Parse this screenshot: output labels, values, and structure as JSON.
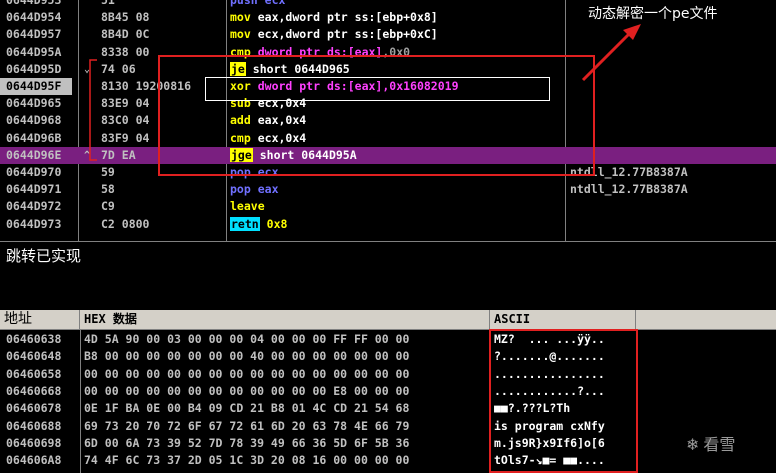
{
  "disasm": {
    "rows": [
      {
        "addr": "0644D953",
        "bytes": "51",
        "op": "push",
        "args": [
          {
            "t": "ecx",
            "c": "push"
          }
        ],
        "comment": ""
      },
      {
        "addr": "0644D954",
        "bytes": "8B45 08",
        "op": "mov",
        "args": [
          {
            "t": "eax,dword ptr ss:[ebp+0x8]",
            "c": "w"
          }
        ],
        "comment": ""
      },
      {
        "addr": "0644D957",
        "bytes": "8B4D 0C",
        "op": "mov",
        "args": [
          {
            "t": "ecx,dword ptr ss:[ebp+0xC]",
            "c": "w"
          }
        ],
        "comment": ""
      },
      {
        "addr": "0644D95A",
        "bytes": "8338 00",
        "op": "cmp",
        "args": [
          {
            "t": "dword ptr ds:[eax]",
            "c": "mem"
          },
          {
            "t": ",0x0",
            "c": "imm"
          }
        ],
        "comment": ""
      },
      {
        "addr": "0644D95D",
        "bytes": "74 06",
        "op": "je",
        "args": [
          {
            "t": "short 0644D965",
            "c": "w"
          }
        ],
        "comment": ""
      },
      {
        "addr": "0644D95F",
        "bytes": "8130 19200816",
        "op": "xor",
        "args": [
          {
            "t": "dword ptr ds:[eax]",
            "c": "mem"
          },
          {
            "t": ",0x16082019",
            "c": "imm"
          }
        ],
        "comment": ""
      },
      {
        "addr": "0644D965",
        "bytes": "83E9 04",
        "op": "sub",
        "args": [
          {
            "t": "ecx,0x4",
            "c": "w"
          }
        ],
        "comment": ""
      },
      {
        "addr": "0644D968",
        "bytes": "83C0 04",
        "op": "add",
        "args": [
          {
            "t": "eax,0x4",
            "c": "w"
          }
        ],
        "comment": ""
      },
      {
        "addr": "0644D96B",
        "bytes": "83F9 04",
        "op": "cmp",
        "args": [
          {
            "t": "ecx,0x4",
            "c": "w"
          }
        ],
        "comment": ""
      },
      {
        "addr": "0644D96E",
        "bytes": "7D EA",
        "op": "jge",
        "args": [
          {
            "t": "short 0644D95A",
            "c": "w"
          }
        ],
        "comment": ""
      },
      {
        "addr": "0644D970",
        "bytes": "59",
        "op": "pop",
        "args": [
          {
            "t": "ecx",
            "c": "push"
          }
        ],
        "comment": "ntdll_12.77B8387A"
      },
      {
        "addr": "0644D971",
        "bytes": "58",
        "op": "pop",
        "args": [
          {
            "t": "eax",
            "c": "push"
          }
        ],
        "comment": "ntdll_12.77B8387A"
      },
      {
        "addr": "0644D972",
        "bytes": "C9",
        "op": "leave",
        "args": [],
        "comment": ""
      },
      {
        "addr": "0644D973",
        "bytes": "C2 0800",
        "op": "retn",
        "args": [
          {
            "t": "0x8",
            "c": "imm"
          }
        ],
        "comment": ""
      }
    ]
  },
  "info_pane": {
    "text": "跳转已实现"
  },
  "annotation": {
    "text": "动态解密一个pe文件"
  },
  "dump": {
    "headers": {
      "addr": "地址",
      "hex": "HEX 数据",
      "ascii": "ASCII"
    },
    "rows": [
      {
        "addr": "06460638",
        "hex": "4D 5A 90 00 03 00 00 00 04 00 00 00 FF FF 00 00",
        "ascii": "MZ?  ... ...ÿÿ.."
      },
      {
        "addr": "06460648",
        "hex": "B8 00 00 00 00 00 00 00 40 00 00 00 00 00 00 00",
        "ascii": "?.......@......."
      },
      {
        "addr": "06460658",
        "hex": "00 00 00 00 00 00 00 00 00 00 00 00 00 00 00 00",
        "ascii": "................"
      },
      {
        "addr": "06460668",
        "hex": "00 00 00 00 00 00 00 00 00 00 00 00 E8 00 00 00",
        "ascii": "............?..."
      },
      {
        "addr": "06460678",
        "hex": "0E 1F BA 0E 00 B4 09 CD 21 B8 01 4C CD 21 54 68",
        "ascii": "■■?.???L?Th"
      },
      {
        "addr": "06460688",
        "hex": "69 73 20 70 72 6F 67 72 61 6D 20 63 78 4E 66 79",
        "ascii": "is program cxNfy"
      },
      {
        "addr": "06460698",
        "hex": "6D 00 6A 73 39 52 7D 78 39 49 66 36 5D 6F 5B 36",
        "ascii": "m.js9R}x9If6]o[6"
      },
      {
        "addr": "064606A8",
        "hex": "74 4F 6C 73 37 2D 05 1C 3D 20 08 16 00 00 00 00",
        "ascii": "tOls7-↘■= ■■...."
      }
    ]
  },
  "watermark": {
    "text": "看雪"
  },
  "colors": {
    "highlight": "#7a1f80",
    "annotation_red": "#e02020",
    "keyword_yellow": "#ffff00",
    "memory_magenta": "#ff40ff"
  }
}
